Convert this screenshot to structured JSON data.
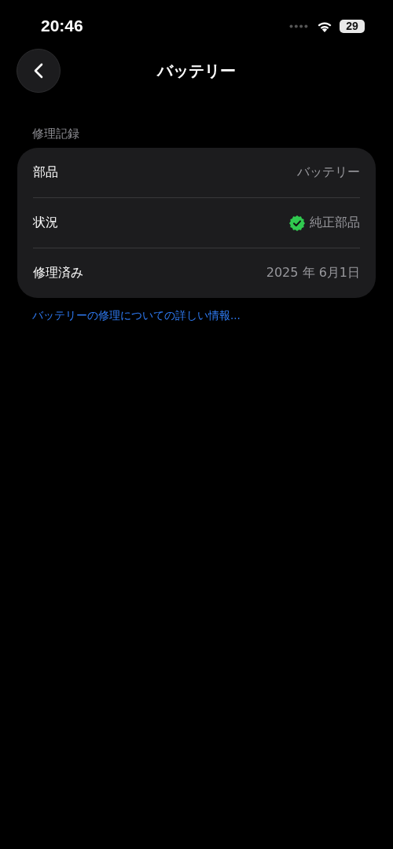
{
  "status_bar": {
    "time": "20:46",
    "battery": "29"
  },
  "nav": {
    "title": "バッテリー"
  },
  "section": {
    "header": "修理記録",
    "rows": [
      {
        "label": "部品",
        "value": "バッテリー",
        "kind": "text"
      },
      {
        "label": "状況",
        "value": "純正部品",
        "kind": "verified"
      },
      {
        "label": "修理済み",
        "value": "2025 年 6月1日",
        "kind": "text"
      }
    ]
  },
  "link": "バッテリーの修理についての詳しい情報..."
}
